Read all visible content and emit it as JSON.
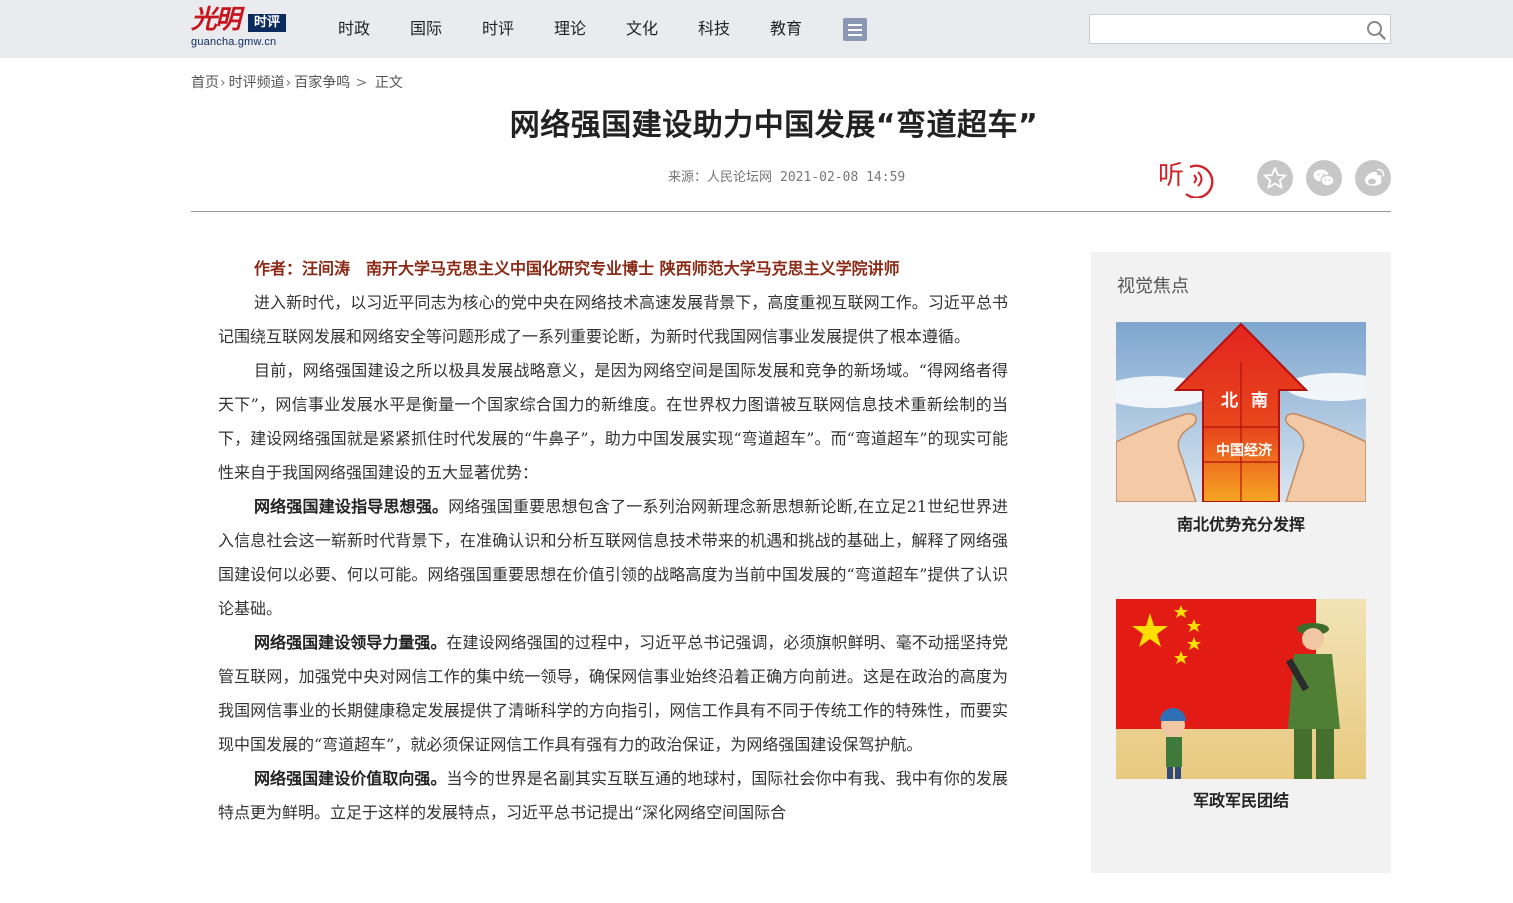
{
  "header": {
    "logo": {
      "brand": "光明",
      "tag": "时评",
      "domain": "guancha.gmw.cn"
    },
    "nav": [
      "时政",
      "国际",
      "时评",
      "理论",
      "文化",
      "科技",
      "教育"
    ],
    "search": {
      "placeholder": "",
      "value": ""
    }
  },
  "breadcrumb": [
    "首页",
    "时评频道",
    "百家争鸣",
    "正文"
  ],
  "article": {
    "title": "网络强国建设助力中国发展“弯道超车”",
    "source": "来源：人民论坛网",
    "time": "2021-02-08 14:59",
    "listen_label": "听",
    "author": "作者：汪间涛　南开大学马克思主义中国化研究专业博士 陕西师范大学马克思主义学院讲师",
    "paragraphs": [
      {
        "bold": "",
        "text": "进入新时代，以习近平同志为核心的党中央在网络技术高速发展背景下，高度重视互联网工作。习近平总书记围绕互联网发展和网络安全等问题形成了一系列重要论断，为新时代我国网信事业发展提供了根本遵循。"
      },
      {
        "bold": "",
        "text": "目前，网络强国建设之所以极具发展战略意义，是因为网络空间是国际发展和竞争的新场域。“得网络者得天下”，网信事业发展水平是衡量一个国家综合国力的新维度。在世界权力图谱被互联网信息技术重新绘制的当下，建设网络强国就是紧紧抓住时代发展的“牛鼻子”，助力中国发展实现“弯道超车”。而“弯道超车”的现实可能性来自于我国网络强国建设的五大显著优势："
      },
      {
        "bold": "网络强国建设指导思想强。",
        "text": "网络强国重要思想包含了一系列治网新理念新思想新论断,在立足21世纪世界进入信息社会这一崭新时代背景下，在准确认识和分析互联网信息技术带来的机遇和挑战的基础上，解释了网络强国建设何以必要、何以可能。网络强国重要思想在价值引领的战略高度为当前中国发展的“弯道超车”提供了认识论基础。"
      },
      {
        "bold": "网络强国建设领导力量强。",
        "text": "在建设网络强国的过程中，习近平总书记强调，必须旗帜鲜明、毫不动摇坚持党管互联网，加强党中央对网信工作的集中统一领导，确保网信事业始终沿着正确方向前进。这是在政治的高度为我国网信事业的长期健康稳定发展提供了清晰科学的方向指引，网信工作具有不同于传统工作的特殊性，而要实现中国发展的“弯道超车”，就必须保证网信工作具有强有力的政治保证，为网络强国建设保驾护航。"
      },
      {
        "bold": "网络强国建设价值取向强。",
        "text": "当今的世界是名副其实互联互通的地球村，国际社会你中有我、我中有你的发展特点更为鲜明。立足于这样的发展特点，习近平总书记提出“深化网络空间国际合"
      }
    ]
  },
  "sidebar": {
    "title": "视觉焦点",
    "items": [
      {
        "caption": "南北优势充分发挥",
        "image_text": [
          "北",
          "南",
          "中国经济"
        ]
      },
      {
        "caption": "军政军民团结"
      }
    ]
  },
  "colors": {
    "header_bg": "#e9ebee",
    "accent_red": "#c8151d",
    "author_color": "#8b2a16"
  }
}
